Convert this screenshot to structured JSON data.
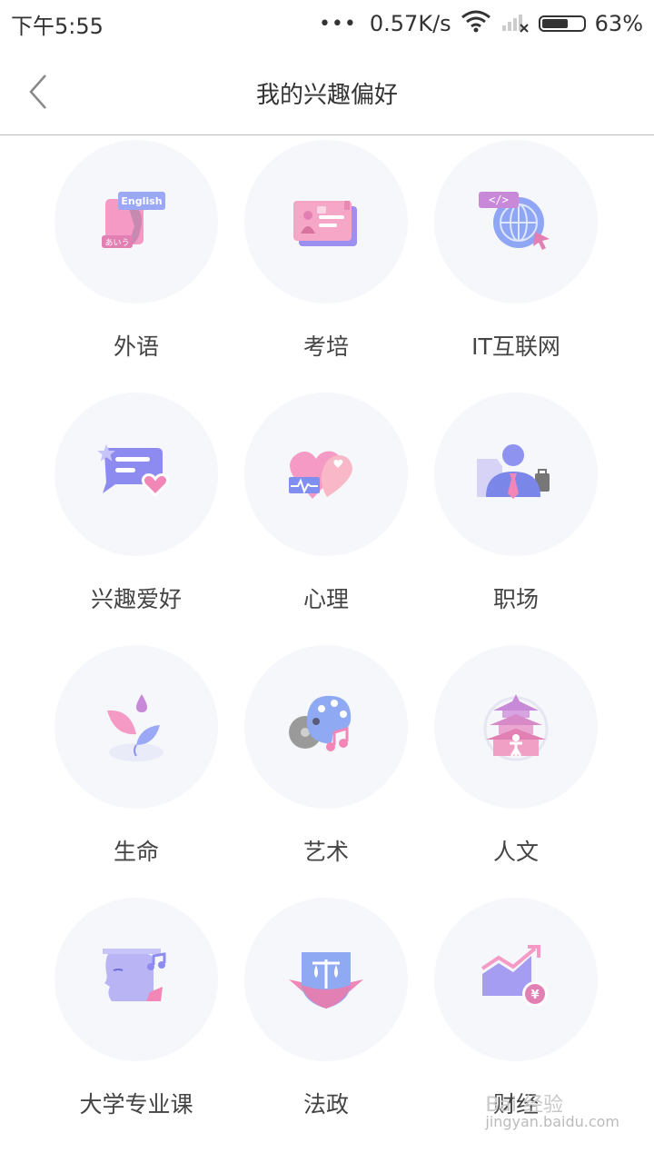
{
  "status_bar": {
    "time": "下午5:55",
    "dots": "•••",
    "speed": "0.57K/s",
    "battery": "63%",
    "battery_level": 0.63
  },
  "nav": {
    "title": "我的兴趣偏好"
  },
  "colors": {
    "circle_bg": "#f6f7fb",
    "accent_pink": "#f07bb0",
    "accent_purple": "#8f8ff0"
  },
  "categories": [
    {
      "label": "外语",
      "icon": "language-book-icon"
    },
    {
      "label": "考培",
      "icon": "id-card-icon"
    },
    {
      "label": "IT互联网",
      "icon": "globe-code-icon"
    },
    {
      "label": "兴趣爱好",
      "icon": "chat-heart-icon"
    },
    {
      "label": "心理",
      "icon": "heart-pulse-icon"
    },
    {
      "label": "职场",
      "icon": "businessman-icon"
    },
    {
      "label": "生命",
      "icon": "leaf-drop-icon"
    },
    {
      "label": "艺术",
      "icon": "palette-music-icon"
    },
    {
      "label": "人文",
      "icon": "pagoda-icon"
    },
    {
      "label": "大学专业课",
      "icon": "head-music-icon"
    },
    {
      "label": "法政",
      "icon": "scales-shield-icon"
    },
    {
      "label": "财经",
      "icon": "chart-yuan-icon"
    }
  ],
  "watermark": {
    "line1": "Bai 经验",
    "line2": "jingyan.baidu.com"
  }
}
